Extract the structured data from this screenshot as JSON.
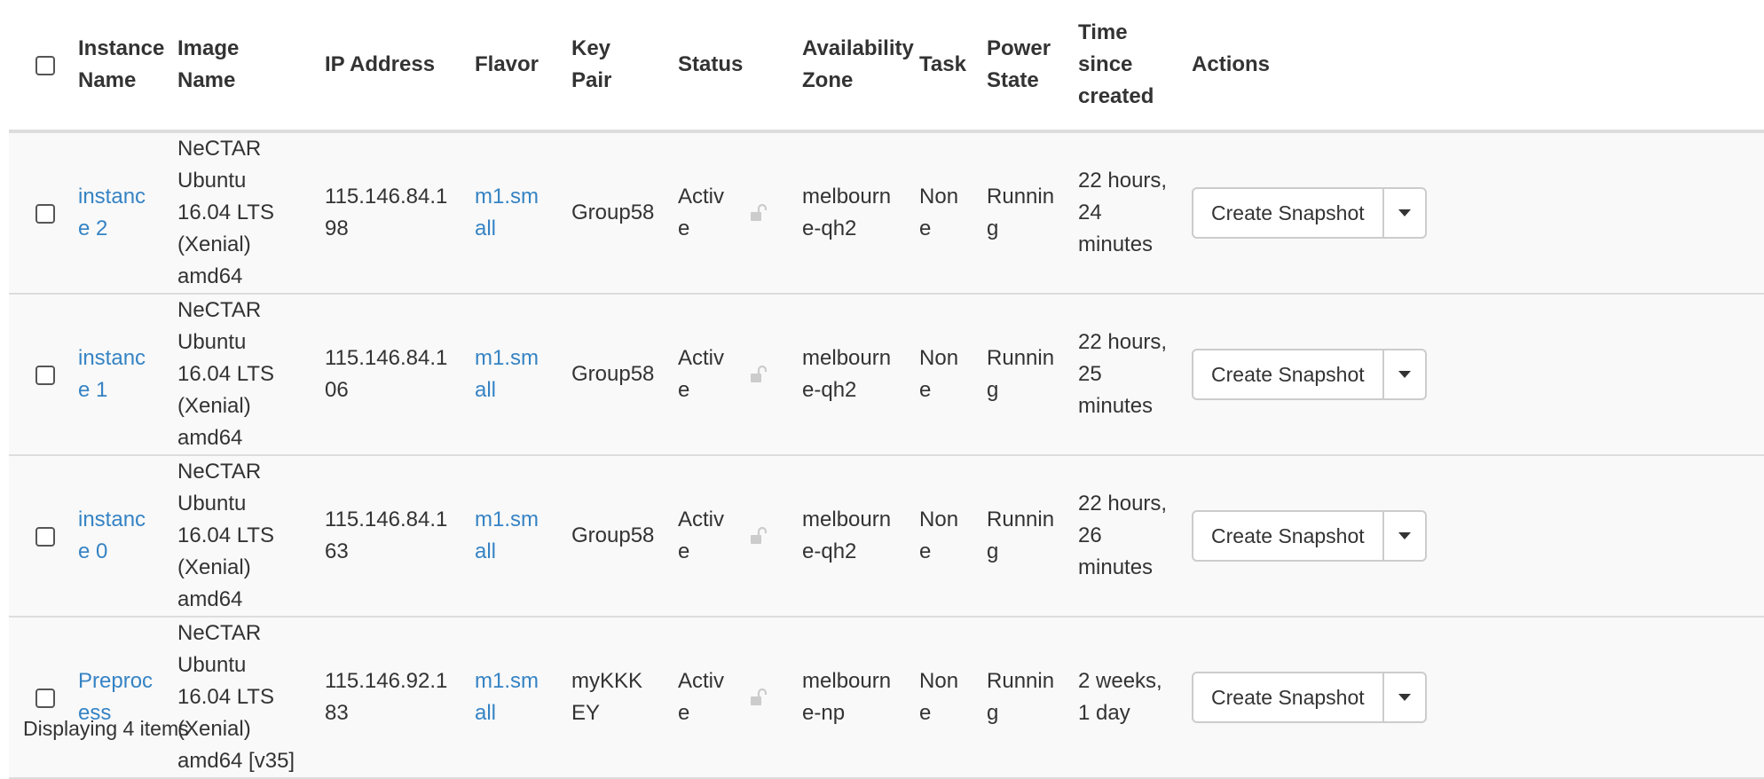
{
  "headers": {
    "instance_name": "Instance Name",
    "image_name": "Image Name",
    "ip_address": "IP Address",
    "flavor": "Flavor",
    "key_pair": "Key Pair",
    "status": "Status",
    "availability_zone": "Availability Zone",
    "task": "Task",
    "power_state": "Power State",
    "time_since_created": "Time since created",
    "actions": "Actions"
  },
  "rows": [
    {
      "instance_name": "instance 2",
      "image_name": "NeCTAR Ubuntu 16.04 LTS (Xenial) amd64",
      "ip_address": "115.146.84.198",
      "flavor": "m1.small",
      "key_pair": "Group58",
      "status": "Active",
      "availability_zone": "melbourne-qh2",
      "task": "None",
      "power_state": "Running",
      "time_since_created": "22 hours, 24 minutes",
      "action_label": "Create Snapshot"
    },
    {
      "instance_name": "instance 1",
      "image_name": "NeCTAR Ubuntu 16.04 LTS (Xenial) amd64",
      "ip_address": "115.146.84.106",
      "flavor": "m1.small",
      "key_pair": "Group58",
      "status": "Active",
      "availability_zone": "melbourne-qh2",
      "task": "None",
      "power_state": "Running",
      "time_since_created": "22 hours, 25 minutes",
      "action_label": "Create Snapshot"
    },
    {
      "instance_name": "instance 0",
      "image_name": "NeCTAR Ubuntu 16.04 LTS (Xenial) amd64",
      "ip_address": "115.146.84.163",
      "flavor": "m1.small",
      "key_pair": "Group58",
      "status": "Active",
      "availability_zone": "melbourne-qh2",
      "task": "None",
      "power_state": "Running",
      "time_since_created": "22 hours, 26 minutes",
      "action_label": "Create Snapshot"
    },
    {
      "instance_name": "Preprocess",
      "image_name": "NeCTAR Ubuntu 16.04 LTS (Xenial) amd64 [v35]",
      "ip_address": "115.146.92.183",
      "flavor": "m1.small",
      "key_pair": "myKKKEY",
      "status": "Active",
      "availability_zone": "melbourne-np",
      "task": "None",
      "power_state": "Running",
      "time_since_created": "2 weeks, 1 day",
      "action_label": "Create Snapshot"
    }
  ],
  "footer": {
    "summary": "Displaying 4 items"
  },
  "colors": {
    "link": "#3583c4",
    "row_bg": "#f9f9f9",
    "border": "#dddddd"
  },
  "icons": {
    "lock": "lock-open-icon",
    "caret": "caret-down-icon"
  }
}
